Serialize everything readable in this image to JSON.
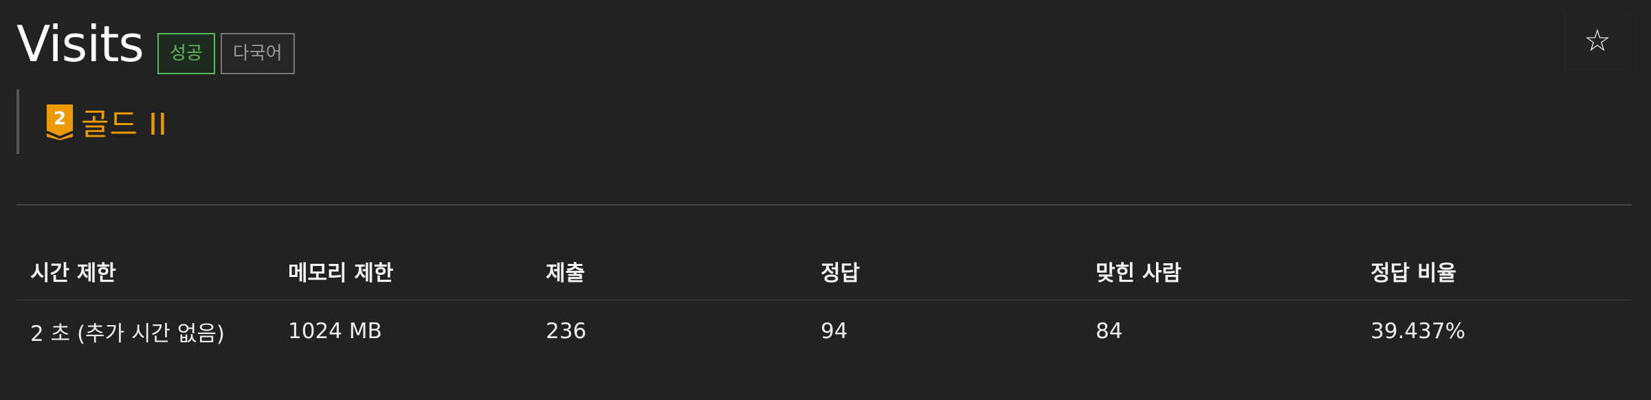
{
  "problem": {
    "title": "Visits",
    "tags": [
      {
        "label": "성공",
        "kind": "success"
      },
      {
        "label": "다국어",
        "kind": "multilang"
      }
    ],
    "star_icon": "star-outline-icon",
    "star_glyph": "☆"
  },
  "tier": {
    "icon": "gold-tier-badge-icon",
    "badge_number": "2",
    "label": "골드 II",
    "color": "#ec9a00"
  },
  "stats": {
    "headers": [
      "시간 제한",
      "메모리 제한",
      "제출",
      "정답",
      "맞힌 사람",
      "정답 비율"
    ],
    "values": [
      "2 초 (추가 시간 없음)",
      "1024 MB",
      "236",
      "94",
      "84",
      "39.437%"
    ]
  },
  "colors": {
    "background": "#222222",
    "success": "#5cb85c",
    "tier_gold": "#ec9a00",
    "divider": "#444444"
  }
}
